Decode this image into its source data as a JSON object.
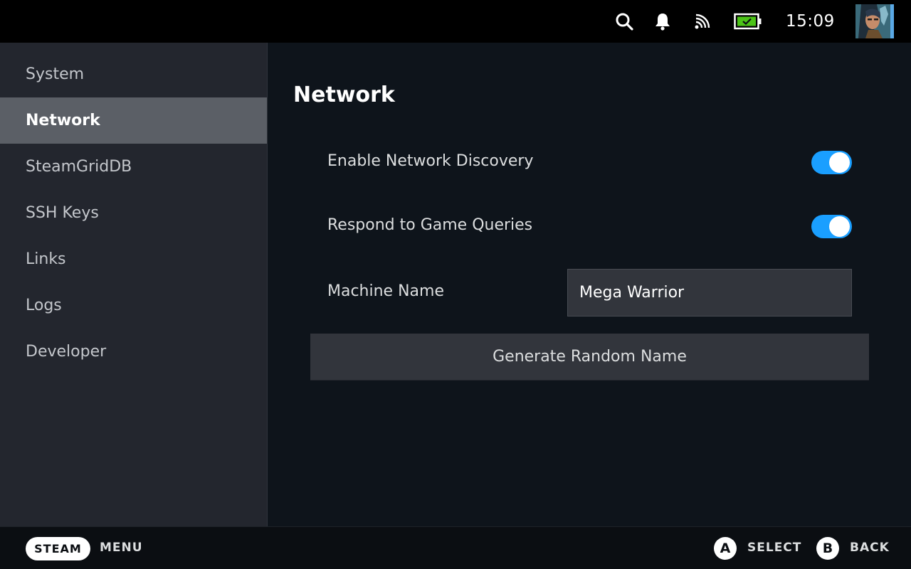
{
  "topbar": {
    "clock": "15:09",
    "icons": [
      "search-icon",
      "bell-icon",
      "cast-icon",
      "battery-icon"
    ],
    "battery_color": "#4cc417"
  },
  "sidebar": {
    "items": [
      {
        "label": "System",
        "active": false
      },
      {
        "label": "Network",
        "active": true
      },
      {
        "label": "SteamGridDB",
        "active": false
      },
      {
        "label": "SSH Keys",
        "active": false
      },
      {
        "label": "Links",
        "active": false
      },
      {
        "label": "Logs",
        "active": false
      },
      {
        "label": "Developer",
        "active": false
      }
    ]
  },
  "main": {
    "title": "Network",
    "settings": [
      {
        "label": "Enable Network Discovery",
        "enabled": true
      },
      {
        "label": "Respond to Game Queries",
        "enabled": true
      }
    ],
    "machine_name": {
      "label": "Machine Name",
      "value": "Mega Warrior"
    },
    "generate_button": "Generate Random Name"
  },
  "bottombar": {
    "steam_label": "STEAM",
    "menu_label": "MENU",
    "select_key": "A",
    "select_label": "SELECT",
    "back_key": "B",
    "back_label": "BACK"
  },
  "colors": {
    "accent": "#1a9fff",
    "sidebar_bg": "#23262e",
    "main_bg": "#0e141b",
    "active_item_bg": "#5b5f66"
  }
}
